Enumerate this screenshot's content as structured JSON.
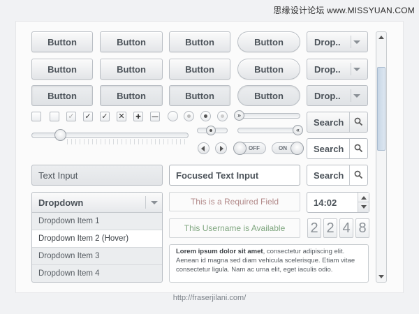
{
  "watermark": {
    "cn": "思缘设计论坛",
    "site": "www.MISSYUAN.COM"
  },
  "buttons": {
    "label": "Button",
    "dropdown_label": "Drop.."
  },
  "search": {
    "label": "Search"
  },
  "toggles": {
    "off": "OFF",
    "on": "ON"
  },
  "checkboxes": {
    "check": "✓",
    "cross": "✕",
    "plus": "✚",
    "minus": "—"
  },
  "fields": {
    "text_input": "Text Input",
    "focused_input": "Focused Text Input"
  },
  "dropdown": {
    "label": "Dropdown",
    "items": [
      "Dropdown Item 1",
      "Dropdown Item 2 (Hover)",
      "Dropdown Item 3",
      "Dropdown Item 4"
    ]
  },
  "notes": {
    "required": "This is a Required Field",
    "available": "This Username is Available"
  },
  "time_spinner": {
    "value": "14:02"
  },
  "counter": {
    "digits": [
      "2",
      "2",
      "4",
      "8"
    ]
  },
  "lorem": {
    "bold": "Lorem ipsum dolor sit amet",
    "rest": ", consectetur adipiscing elit. Aenean id magna sed diam vehicula scelerisque. Etiam vitae consectetur ligula. Nam ac urna elit, eget iaculis odio."
  },
  "footer": {
    "url": "http://fraserjilani.com/"
  },
  "colors": {
    "required_text": "#b28a8a",
    "available_text": "#7fa67f",
    "scroll_thumb": "#c7d6e6"
  },
  "sliders": {
    "main_value": 0.18,
    "small_value": 0.45
  }
}
